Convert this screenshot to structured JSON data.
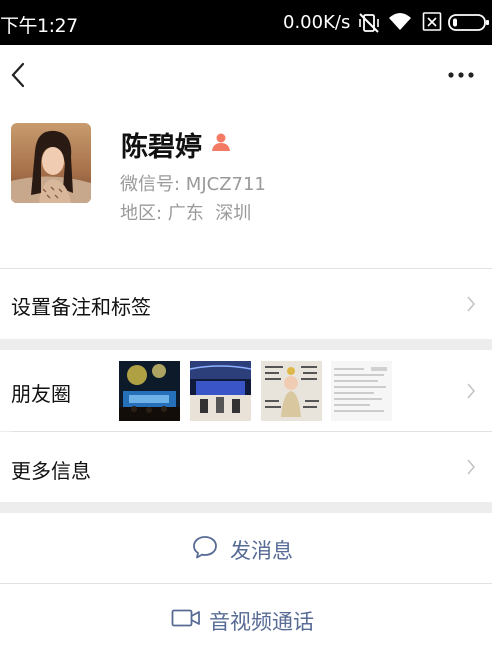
{
  "status_bar": {
    "time": "下午1:27",
    "network_speed": "0.00K/s",
    "icons": [
      "mute-vibrate-icon",
      "wifi-icon",
      "sim-disabled-icon",
      "battery-icon"
    ]
  },
  "nav": {
    "back_icon": "chevron-left-icon",
    "more_icon": "more-dots-icon"
  },
  "profile": {
    "name": "陈碧婷",
    "gender_icon": "person-icon",
    "gender_color": "#f37b63",
    "wechat_id": "微信号: MJCZ711",
    "region": "地区: 广东  深圳"
  },
  "menu": {
    "remark_tags": "设置备注和标签",
    "moments": "朋友圈",
    "more_info": "更多信息"
  },
  "actions": {
    "send_message": "发消息",
    "video_call": "音视频通话"
  },
  "colors": {
    "accent": "#576b95",
    "background": "#ededed",
    "secondary_text": "#9a9a9a"
  }
}
